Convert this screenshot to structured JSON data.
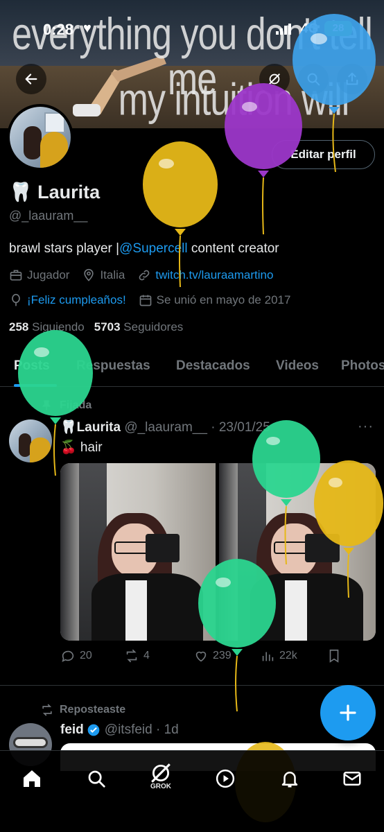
{
  "status_bar": {
    "time": "0:28",
    "network": "4G",
    "battery": "28"
  },
  "banner": {
    "line1": "everything you don't tell me",
    "line2": "my intuition will"
  },
  "header_buttons": {
    "back": "arrow-left-icon",
    "grok": "grok-icon",
    "search": "search-icon",
    "share": "share-icon"
  },
  "profile": {
    "edit_label": "Editar perfil",
    "name_prefix": "🦷",
    "name": "Laurita",
    "handle": "@_laauram__",
    "bio_before": "brawl stars player |",
    "bio_link": "@Supercell",
    "bio_after": " content creator",
    "category": "Jugador",
    "location": "Italia",
    "website": "twitch.tv/lauraamartino",
    "birthday": "¡Feliz cumpleaños!",
    "joined": "Se unió en mayo de 2017",
    "following_count": "258",
    "following_label": "Siguiendo",
    "followers_count": "5703",
    "followers_label": "Seguidores"
  },
  "tabs": [
    "Posts",
    "Respuestas",
    "Destacados",
    "Videos",
    "Photos"
  ],
  "pinned_post": {
    "pinned_label": "Fijada",
    "name": "Laurita",
    "handle": "@_laauram__",
    "date": "· 23/01/25",
    "text": "🍒 hair",
    "replies": "20",
    "reposts": "4",
    "likes": "239",
    "views": "22k"
  },
  "repost": {
    "label": "Reposteaste",
    "name": "feid",
    "handle": "@itsfeid",
    "time": "· 1d"
  },
  "bottom_nav": {
    "home": "home-icon",
    "search": "search-icon",
    "grok_label": "GROK",
    "video": "play-icon",
    "notifications": "bell-icon",
    "messages": "mail-icon"
  },
  "colors": {
    "accent": "#1d9bf0",
    "secondary_text": "#71767b",
    "balloon_blue": "#3ea2ea",
    "balloon_purple": "#9c37c9",
    "balloon_yellow": "#e6b818",
    "balloon_green": "#2bd58f"
  }
}
